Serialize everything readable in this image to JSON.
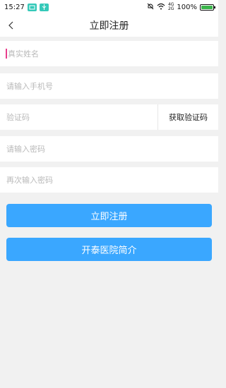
{
  "status_bar": {
    "time": "15:27",
    "signal_top": "4G",
    "signal_bottom": "2G",
    "battery": "100%",
    "battery_level": 1.0
  },
  "header": {
    "title": "立即注册"
  },
  "form": {
    "name_placeholder": "真实姓名",
    "phone_placeholder": "请输入手机号",
    "code_placeholder": "验证码",
    "get_code_label": "获取验证码",
    "password_placeholder": "请输入密码",
    "confirm_password_placeholder": "再次输入密码"
  },
  "actions": {
    "register_label": "立即注册",
    "hospital_intro_label": "开泰医院简介"
  },
  "colors": {
    "primary": "#3aa7ff",
    "background": "#f1f1f1",
    "cursor": "#e83e8c"
  }
}
